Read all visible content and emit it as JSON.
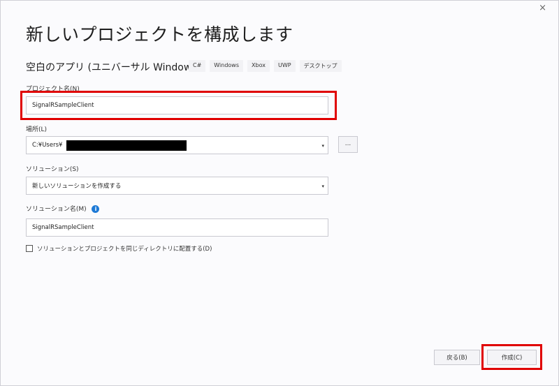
{
  "window": {
    "close_glyph": "×"
  },
  "page": {
    "title": "新しいプロジェクトを構成します",
    "template_name": "空白のアプリ (ユニバーサル Windows)",
    "tags": [
      "C#",
      "Windows",
      "Xbox",
      "UWP",
      "デスクトップ"
    ]
  },
  "form": {
    "project_name_label": "プロジェクト名(N)",
    "project_name_value": "SignalRSampleClient",
    "location_label": "場所(L)",
    "location_value": "C:¥Users¥",
    "browse_label": "...",
    "solution_label": "ソリューション(S)",
    "solution_value": "新しいソリューションを作成する",
    "solution_name_label": "ソリューション名(M)",
    "solution_name_value": "SignalRSampleClient",
    "same_dir_label": "ソリューションとプロジェクトを同じディレクトリに配置する(D)",
    "same_dir_checked": false,
    "info_glyph": "i",
    "dropdown_glyph": "▾"
  },
  "footer": {
    "back_label": "戻る(B)",
    "create_label": "作成(C)"
  },
  "colors": {
    "highlight": "#e00000",
    "info": "#1e7ad6"
  }
}
